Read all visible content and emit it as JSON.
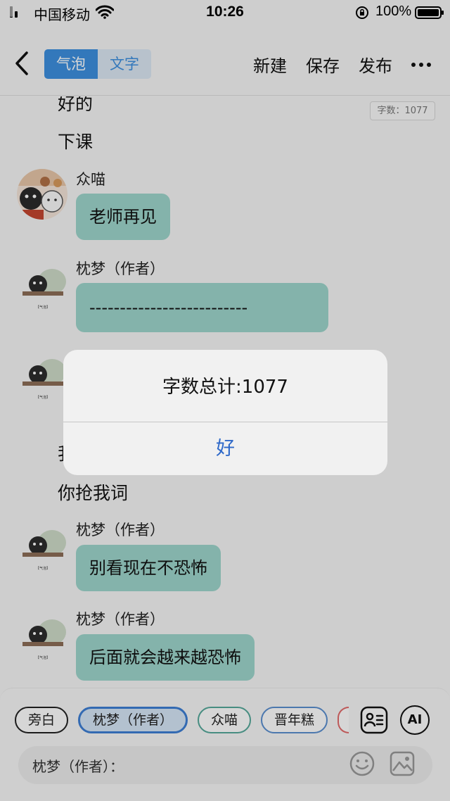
{
  "status_bar": {
    "carrier": "中国移动",
    "time": "10:26",
    "battery": "100%"
  },
  "nav": {
    "tabs": [
      "气泡",
      "文字"
    ],
    "actions": [
      "新建",
      "保存",
      "发布"
    ],
    "icons": [
      "back-icon",
      "more-icon"
    ]
  },
  "chat": {
    "word_count_badge": "字数：1077",
    "narration_top": [
      "好的",
      "下课"
    ],
    "messages": [
      {
        "sender": "众喵",
        "text": "老师再见"
      },
      {
        "sender": "枕梦（作者）",
        "text": "--------------------------"
      },
      {
        "sender": "枕梦（作者）",
        "text": "别看现在不恐怖"
      },
      {
        "sender": "枕梦（作者）",
        "text": "后面就会越来越恐怖"
      }
    ],
    "narration_mid": [
      "我",
      "你抢我词"
    ]
  },
  "toolbar": {
    "characters": [
      "旁白",
      "枕梦（作者）",
      "众喵",
      "晋年糕"
    ],
    "selected_character": "枕梦（作者）",
    "input_label": "枕梦（作者）：",
    "ai_label": "AI"
  },
  "alert": {
    "message": "字数总计:1077",
    "ok": "好"
  },
  "colors": {
    "accent": "#3d8fdf",
    "bubble": "#9ed6cc",
    "alert_button": "#2f69c9"
  }
}
